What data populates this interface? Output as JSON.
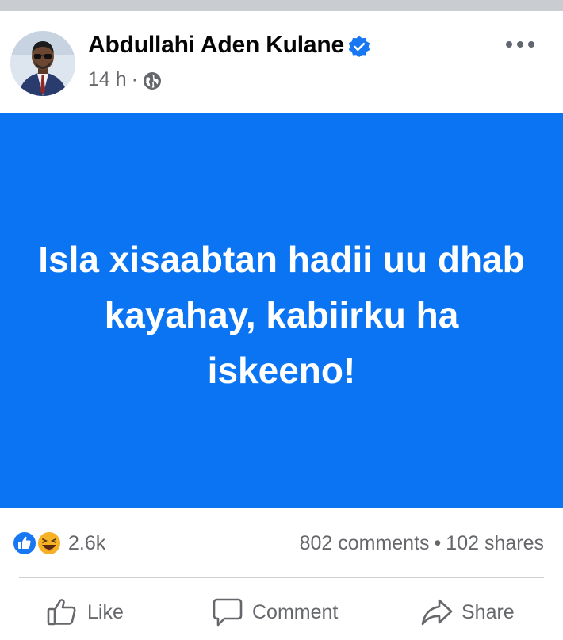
{
  "post": {
    "author_name": "Abdullahi Aden Kulane",
    "timestamp": "14 h",
    "meta_separator": "·",
    "audience_icon": "globe-icon",
    "verified_icon": "verified-badge-icon",
    "text": "Isla xisaabtan hadii uu dhab kayahay, kabiirku ha iskeeno!",
    "background_color": "#0a74f3"
  },
  "stats": {
    "reactions": [
      "like",
      "haha"
    ],
    "reaction_count": "2.6k",
    "comments": "802 comments",
    "separator": "•",
    "shares": "102 shares"
  },
  "actions": {
    "like_label": "Like",
    "comment_label": "Comment",
    "share_label": "Share"
  },
  "colors": {
    "accent": "#1877f2",
    "secondary_text": "#65676b"
  }
}
